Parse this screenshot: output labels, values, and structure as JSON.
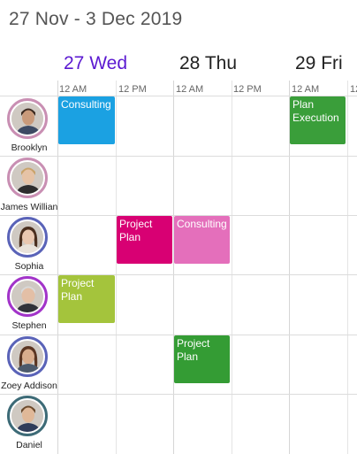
{
  "header": {
    "date_range": "27 Nov - 3 Dec 2019"
  },
  "days": [
    {
      "label": "27 Wed",
      "active": true
    },
    {
      "label": "28 Thu",
      "active": false
    },
    {
      "label": "29 Fri",
      "active": false
    }
  ],
  "time_labels": [
    "12 AM",
    "12 PM",
    "12 AM",
    "12 PM",
    "12 AM",
    "12"
  ],
  "resources": [
    {
      "name": "Brooklyn",
      "ring": "#c98fb3",
      "skin": "#c99a7a",
      "hair": "#3b2a20",
      "shirt": "#3d4a63"
    },
    {
      "name": "James Willian",
      "ring": "#c98fb3",
      "skin": "#e6c3a6",
      "hair": "#caa36a",
      "shirt": "#2d2d2d"
    },
    {
      "name": "Sophia",
      "ring": "#5a63b8",
      "skin": "#e9c7b0",
      "hair": "#4a2e1e",
      "shirt": "#e9e2da"
    },
    {
      "name": "Stephen",
      "ring": "#a234c9",
      "skin": "#e3bfa6",
      "hair": "#d8d8d8",
      "shirt": "#30323a"
    },
    {
      "name": "Zoey Addison",
      "ring": "#5a63b8",
      "skin": "#d9ad8d",
      "hair": "#5a3522",
      "shirt": "#4c5a6c"
    },
    {
      "name": "Daniel",
      "ring": "#3d6b77",
      "skin": "#e0b898",
      "hair": "#6b4a2c",
      "shirt": "#2e3c5a"
    }
  ],
  "appointments": [
    {
      "title": "Consulting",
      "color": "#1ba1e2"
    },
    {
      "title": "Plan Execution",
      "color": "#3a9e3a"
    },
    {
      "title": "Project Plan",
      "color": "#d80073"
    },
    {
      "title": "Consulting",
      "color": "#e46fbb"
    },
    {
      "title": "Project Plan",
      "color": "#a4c43c"
    },
    {
      "title": "Project Plan",
      "color": "#349c34"
    }
  ]
}
